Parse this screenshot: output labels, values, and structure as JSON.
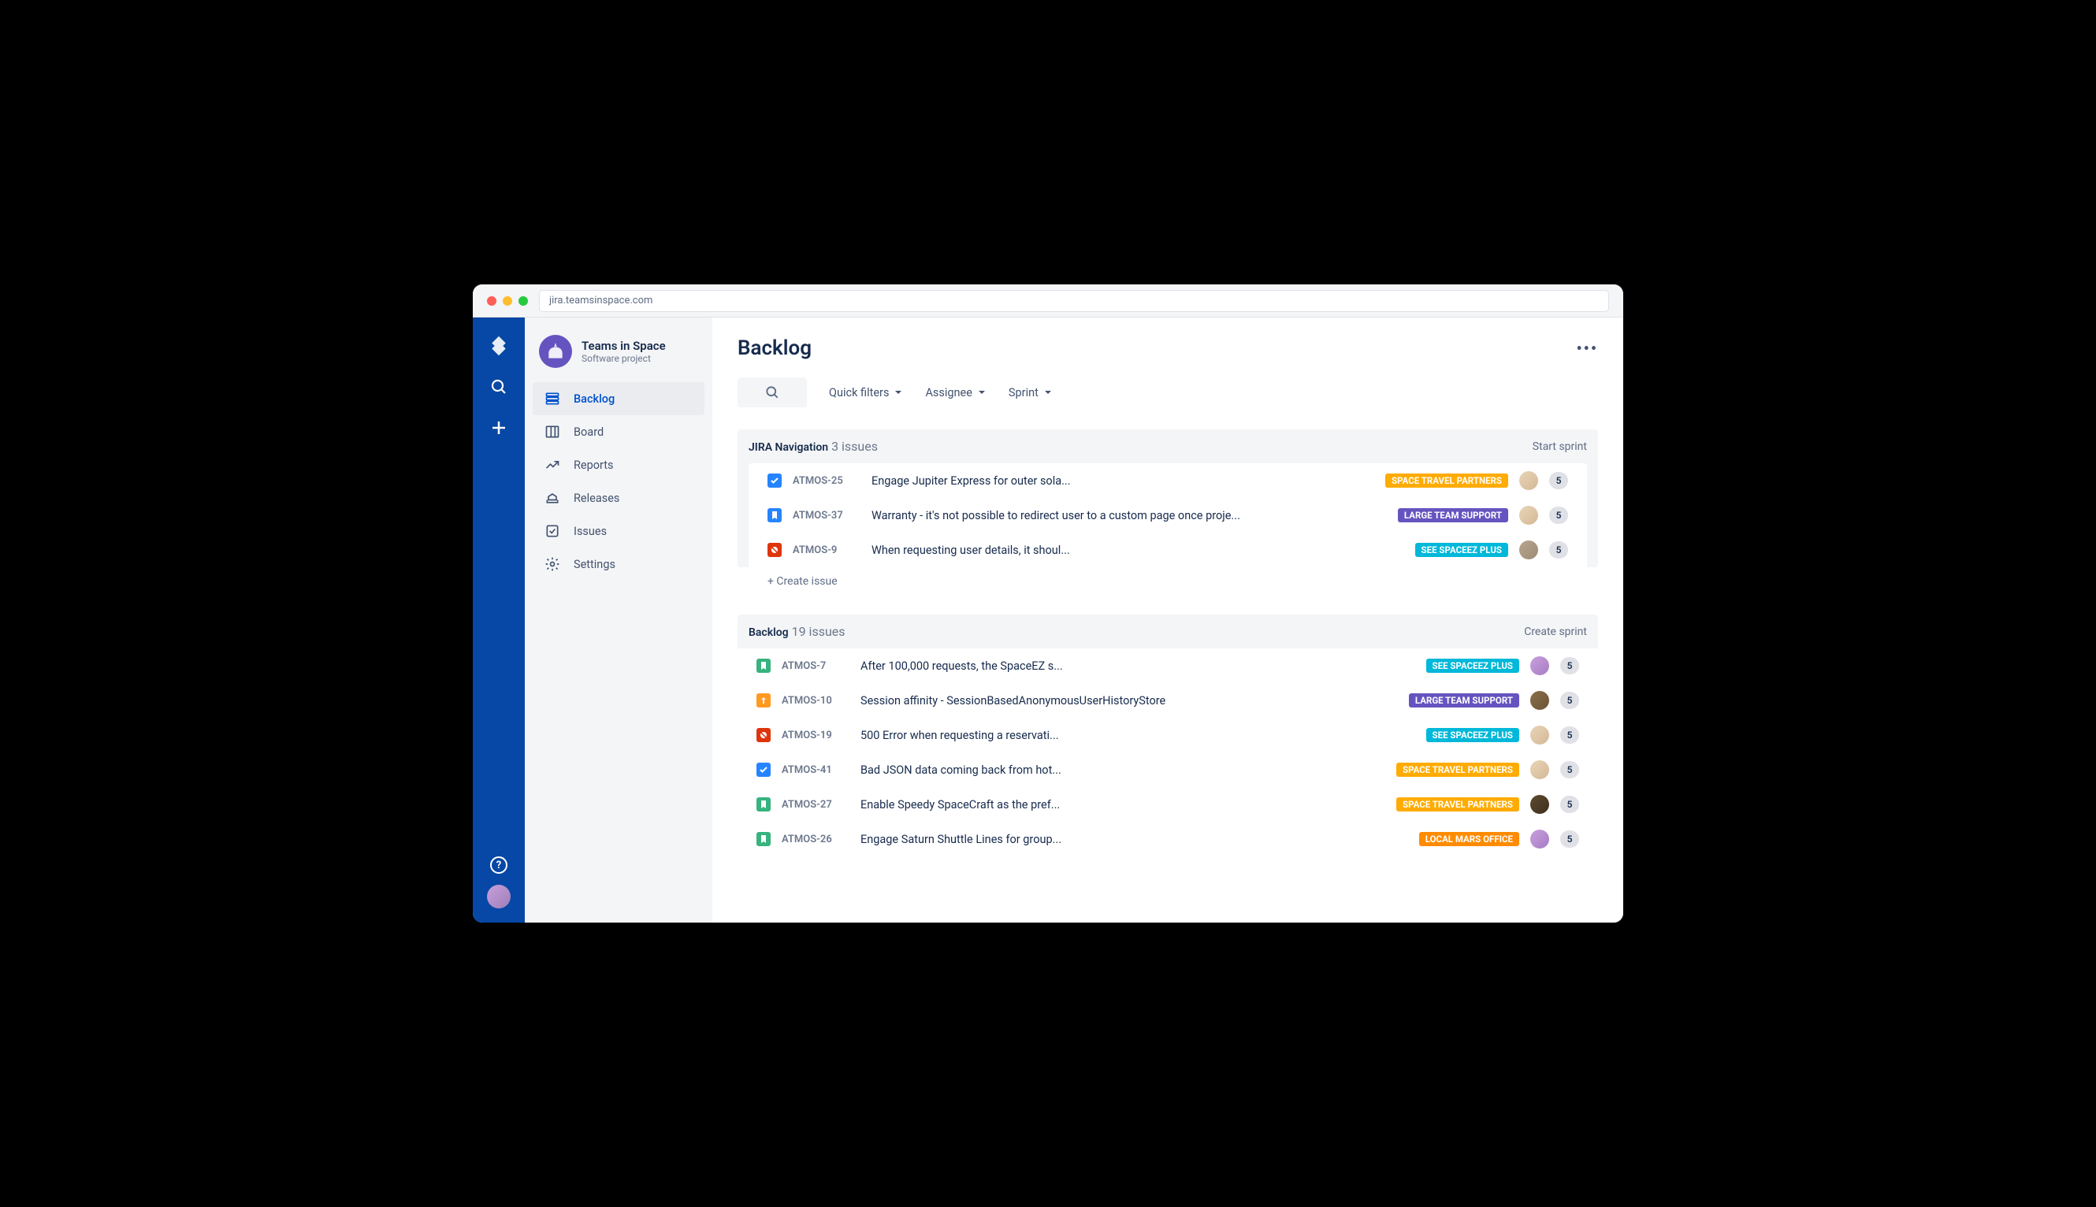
{
  "browser": {
    "url": "jira.teamsinspace.com"
  },
  "project": {
    "name": "Teams in Space",
    "type": "Software project"
  },
  "sidebar": {
    "items": [
      {
        "label": "Backlog"
      },
      {
        "label": "Board"
      },
      {
        "label": "Reports"
      },
      {
        "label": "Releases"
      },
      {
        "label": "Issues"
      },
      {
        "label": "Settings"
      }
    ]
  },
  "page": {
    "title": "Backlog"
  },
  "toolbar": {
    "filters": [
      {
        "label": "Quick filters"
      },
      {
        "label": "Assignee"
      },
      {
        "label": "Sprint"
      }
    ]
  },
  "sections": [
    {
      "title": "JIRA Navigation",
      "count": "3 issues",
      "action": "Start sprint",
      "create_label": "+ Create issue",
      "issues": [
        {
          "type": "task",
          "type_color": "it-blue",
          "key": "ATMOS-25",
          "summary": "Engage Jupiter Express for outer sola...",
          "epic": "SPACE TRAVEL PARTNERS",
          "epic_color": "#ffab00",
          "avatar": "av-1",
          "points": "5"
        },
        {
          "type": "story",
          "type_color": "it-blue",
          "key": "ATMOS-37",
          "summary": "Warranty - it's not possible to redirect user to a custom page once proje...",
          "epic": "LARGE TEAM SUPPORT",
          "epic_color": "#6554c0",
          "avatar": "av-1",
          "points": "5"
        },
        {
          "type": "bug",
          "type_color": "it-red",
          "key": "ATMOS-9",
          "summary": "When requesting user details, it shoul...",
          "epic": "SEE SPACEEZ PLUS",
          "epic_color": "#00b8d9",
          "avatar": "av-3",
          "points": "5"
        }
      ]
    },
    {
      "title": "Backlog",
      "count": "19 issues",
      "action": "Create sprint",
      "issues": [
        {
          "type": "story",
          "type_color": "it-green",
          "key": "ATMOS-7",
          "summary": "After 100,000 requests, the SpaceEZ s...",
          "epic": "SEE SPACEEZ PLUS",
          "epic_color": "#00b8d9",
          "avatar": "av-4",
          "points": "5"
        },
        {
          "type": "improvement",
          "type_color": "it-orange",
          "key": "ATMOS-10",
          "summary": "Session affinity - SessionBasedAnonymousUserHistoryStore",
          "epic": "LARGE TEAM SUPPORT",
          "epic_color": "#6554c0",
          "avatar": "av-5",
          "points": "5"
        },
        {
          "type": "bug",
          "type_color": "it-red",
          "key": "ATMOS-19",
          "summary": "500 Error when requesting a reservati...",
          "epic": "SEE SPACEEZ PLUS",
          "epic_color": "#00b8d9",
          "avatar": "av-1",
          "points": "5"
        },
        {
          "type": "task",
          "type_color": "it-blue",
          "key": "ATMOS-41",
          "summary": "Bad JSON data coming back from hot...",
          "epic": "SPACE TRAVEL PARTNERS",
          "epic_color": "#ffab00",
          "avatar": "av-1",
          "points": "5"
        },
        {
          "type": "story",
          "type_color": "it-green",
          "key": "ATMOS-27",
          "summary": "Enable Speedy SpaceCraft as the pref...",
          "epic": "SPACE TRAVEL PARTNERS",
          "epic_color": "#ffab00",
          "avatar": "av-6",
          "points": "5"
        },
        {
          "type": "story",
          "type_color": "it-green",
          "key": "ATMOS-26",
          "summary": "Engage Saturn Shuttle Lines for group...",
          "epic": "LOCAL MARS OFFICE",
          "epic_color": "#ff8b00",
          "avatar": "av-4",
          "points": "5"
        }
      ]
    }
  ]
}
